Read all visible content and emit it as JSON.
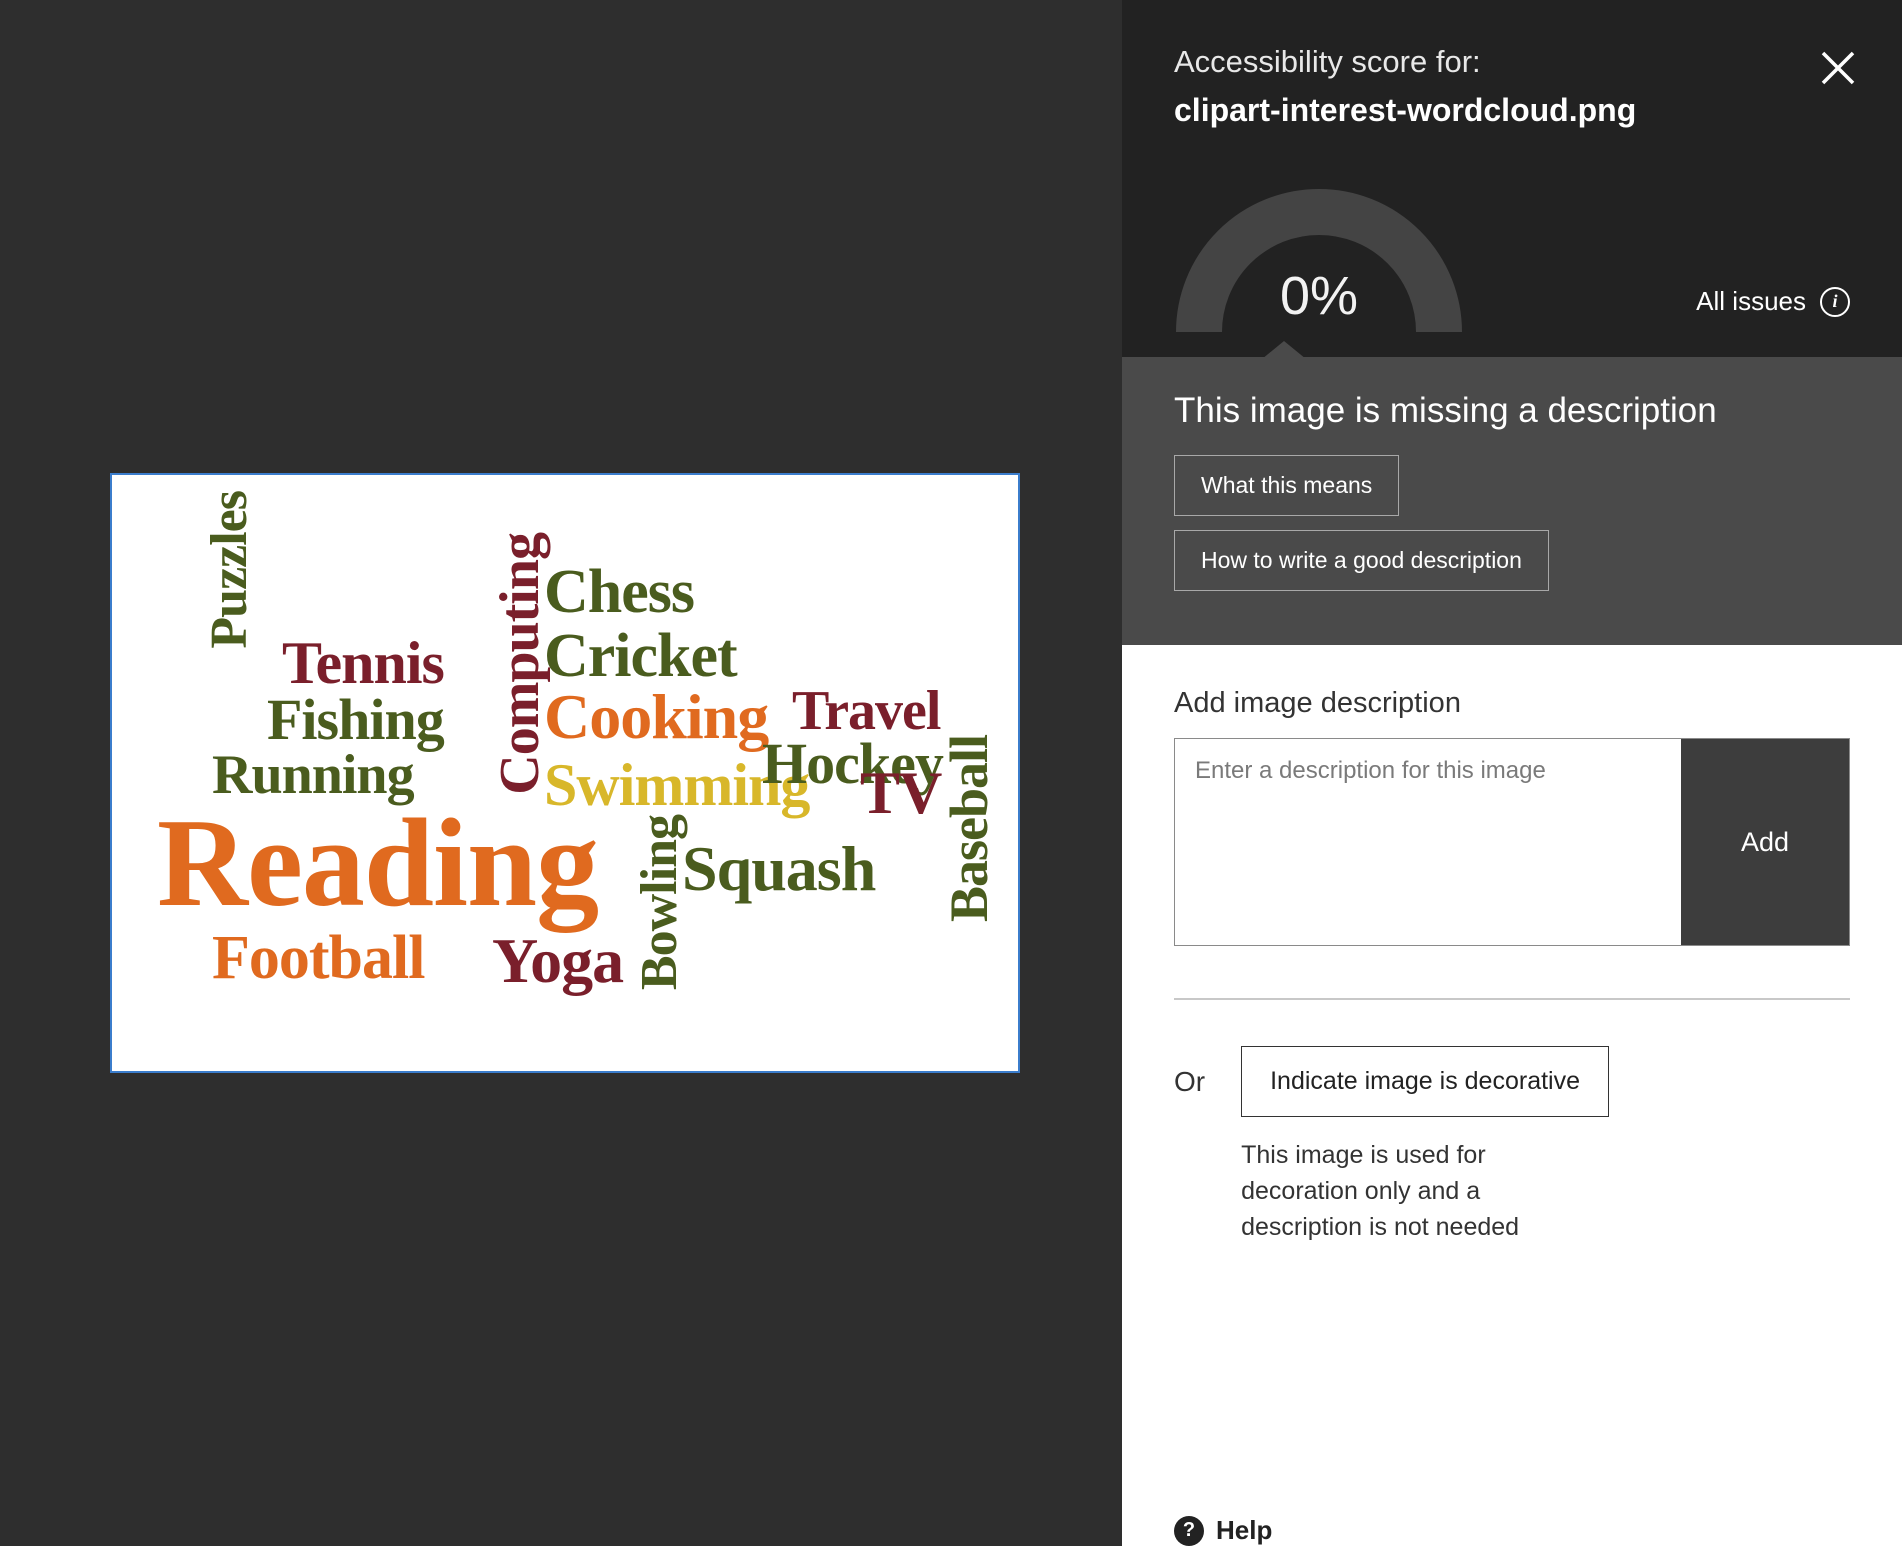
{
  "header": {
    "title_label": "Accessibility score for:",
    "filename": "clipart-interest-wordcloud.png",
    "score_pct": "0%",
    "all_issues_label": "All issues"
  },
  "issue": {
    "heading": "This image is missing a description",
    "what_btn": "What this means",
    "how_btn": "How to write a good description"
  },
  "form": {
    "label": "Add image description",
    "placeholder": "Enter a description for this image",
    "add_btn": "Add",
    "or_label": "Or",
    "decorative_btn": "Indicate image is decorative",
    "decorative_help": "This image is used for decoration only and a description is not needed",
    "help_label": "Help"
  },
  "wordcloud": {
    "words": [
      "Puzzles",
      "Tennis",
      "Fishing",
      "Running",
      "Reading",
      "Football",
      "Computing",
      "Chess",
      "Cricket",
      "Cooking",
      "Swimming",
      "Bowling",
      "Yoga",
      "Squash",
      "Travel",
      "Hockey",
      "TV",
      "Baseball"
    ]
  }
}
